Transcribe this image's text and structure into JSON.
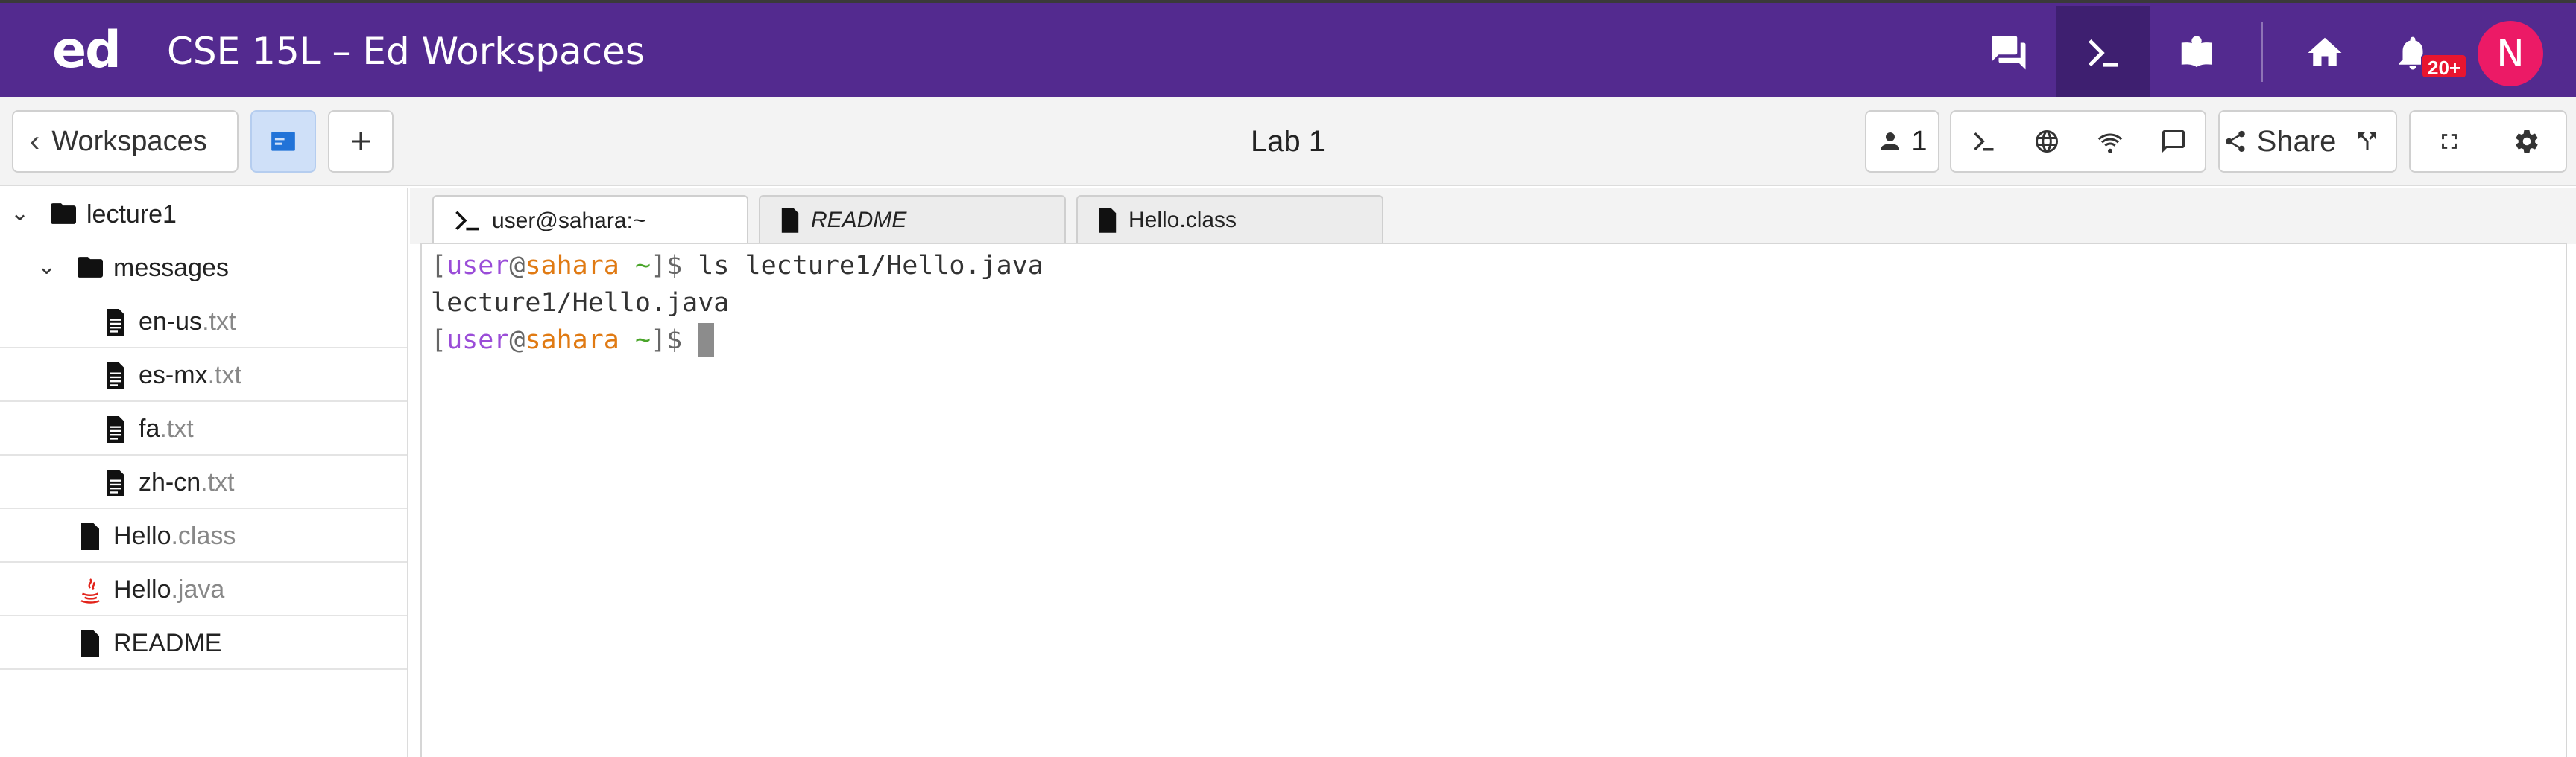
{
  "header": {
    "logo": "ed",
    "title": "CSE 15L – Ed Workspaces",
    "notification_count": "20+",
    "avatar_initial": "N",
    "colors": {
      "bar": "#532a8f",
      "active": "#3e1f70",
      "badge": "#e8152f",
      "avatar": "#ec1a66"
    },
    "icons": [
      "discussion-icon",
      "terminal-icon",
      "lessons-icon",
      "home-icon",
      "bell-icon"
    ]
  },
  "toolbar": {
    "workspaces_label": "Workspaces",
    "lab_title": "Lab 1",
    "users_count": "1",
    "share_label": "Share",
    "icons": [
      "chevron-left-icon",
      "files-icon",
      "plus-icon",
      "user-icon",
      "terminal-icon",
      "globe-icon",
      "wifi-icon",
      "chat-icon",
      "share-icon",
      "fork-icon",
      "fullscreen-icon",
      "gear-icon"
    ]
  },
  "file_tree": [
    {
      "name": "lecture1",
      "ext": "",
      "type": "folder",
      "expanded": true
    },
    {
      "name": "messages",
      "ext": "",
      "type": "folder",
      "expanded": true
    },
    {
      "name": "en-us",
      "ext": ".txt",
      "type": "text-file"
    },
    {
      "name": "es-mx",
      "ext": ".txt",
      "type": "text-file"
    },
    {
      "name": "fa",
      "ext": ".txt",
      "type": "text-file"
    },
    {
      "name": "zh-cn",
      "ext": ".txt",
      "type": "text-file"
    },
    {
      "name": "Hello",
      "ext": ".class",
      "type": "file"
    },
    {
      "name": "Hello",
      "ext": ".java",
      "type": "java-file"
    },
    {
      "name": "README",
      "ext": "",
      "type": "file"
    }
  ],
  "tabs": [
    {
      "label": "user@sahara:~",
      "icon": "terminal-icon",
      "active": true
    },
    {
      "label": "README",
      "icon": "file-icon",
      "active": false
    },
    {
      "label": "Hello.class",
      "icon": "file-icon",
      "active": false
    }
  ],
  "terminal": {
    "prompt": {
      "open": "[",
      "user": "user",
      "at": "@",
      "host": "sahara",
      "path": "~",
      "close": "]$"
    },
    "command": "ls lecture1/Hello.java",
    "output": "lecture1/Hello.java",
    "colors": {
      "user": "#9a4cd8",
      "host": "#e07a13",
      "path": "#4aa52a"
    }
  }
}
